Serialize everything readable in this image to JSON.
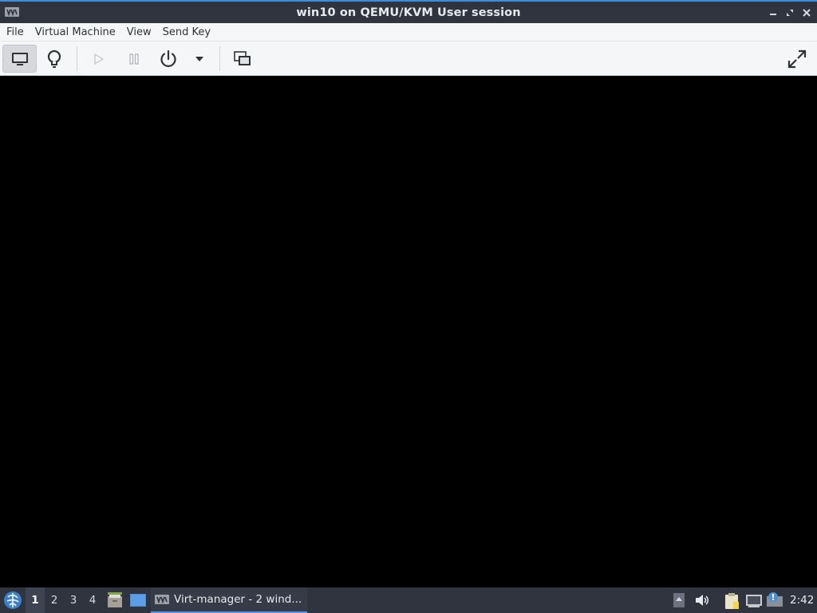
{
  "window": {
    "title": "win10 on QEMU/KVM User session"
  },
  "menubar": {
    "items": [
      {
        "label": "File"
      },
      {
        "label": "Virtual Machine"
      },
      {
        "label": "View"
      },
      {
        "label": "Send Key"
      }
    ]
  },
  "toolbar": {
    "buttons": [
      {
        "icon": "monitor-icon",
        "state": "active"
      },
      {
        "icon": "lightbulb-icon"
      },
      {
        "icon": "play-icon",
        "state": "disabled"
      },
      {
        "icon": "pause-icon",
        "state": "disabled"
      },
      {
        "icon": "power-icon"
      },
      {
        "icon": "chevron-down-icon"
      },
      {
        "icon": "screenshot-icon"
      },
      {
        "icon": "fullscreen-icon"
      }
    ]
  },
  "taskbar": {
    "workspaces": [
      "1",
      "2",
      "3",
      "4"
    ],
    "active_workspace": "1",
    "task_label": "Virt-manager - 2 wind...",
    "clock": "2:42",
    "accent": "#5294e2",
    "tray_icons": [
      "arrow-up-icon",
      "volume-icon",
      "clipboard-icon",
      "network-icon",
      "notification-icon"
    ]
  },
  "colors": {
    "titlebar": "#2f343f",
    "vm_display": "#000000",
    "toolbar": "#f5f6f7"
  }
}
